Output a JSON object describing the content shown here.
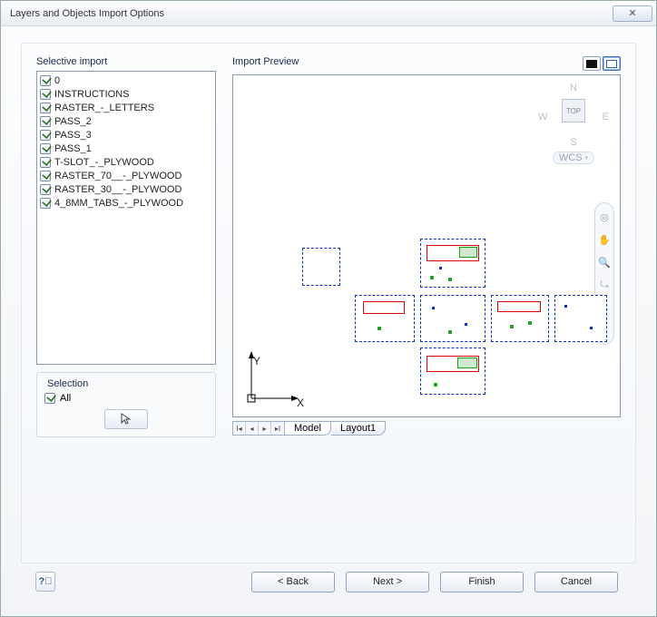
{
  "window": {
    "title": "Layers and Objects Import Options"
  },
  "selective_import": {
    "label": "Selective import",
    "layers": [
      "0",
      "INSTRUCTIONS",
      "RASTER_-_LETTERS",
      "PASS_2",
      "PASS_3",
      "PASS_1",
      "T-SLOT_-_PLYWOOD",
      "RASTER_70__-_PLYWOOD",
      "RASTER_30__-_PLYWOOD",
      "4_8MM_TABS_-_PLYWOOD"
    ]
  },
  "selection": {
    "label": "Selection",
    "all_label": "All",
    "all_checked": true
  },
  "preview": {
    "label": "Import Preview",
    "viewcube": {
      "top": "TOP",
      "n": "N",
      "s": "S",
      "e": "E",
      "w": "W",
      "wcs": "WCS"
    },
    "axes": {
      "x": "X",
      "y": "Y"
    },
    "tabs": {
      "model": "Model",
      "layout1": "Layout1"
    }
  },
  "buttons": {
    "back": "< Back",
    "next": "Next >",
    "finish": "Finish",
    "cancel": "Cancel",
    "help": "?",
    "close": "✕"
  }
}
